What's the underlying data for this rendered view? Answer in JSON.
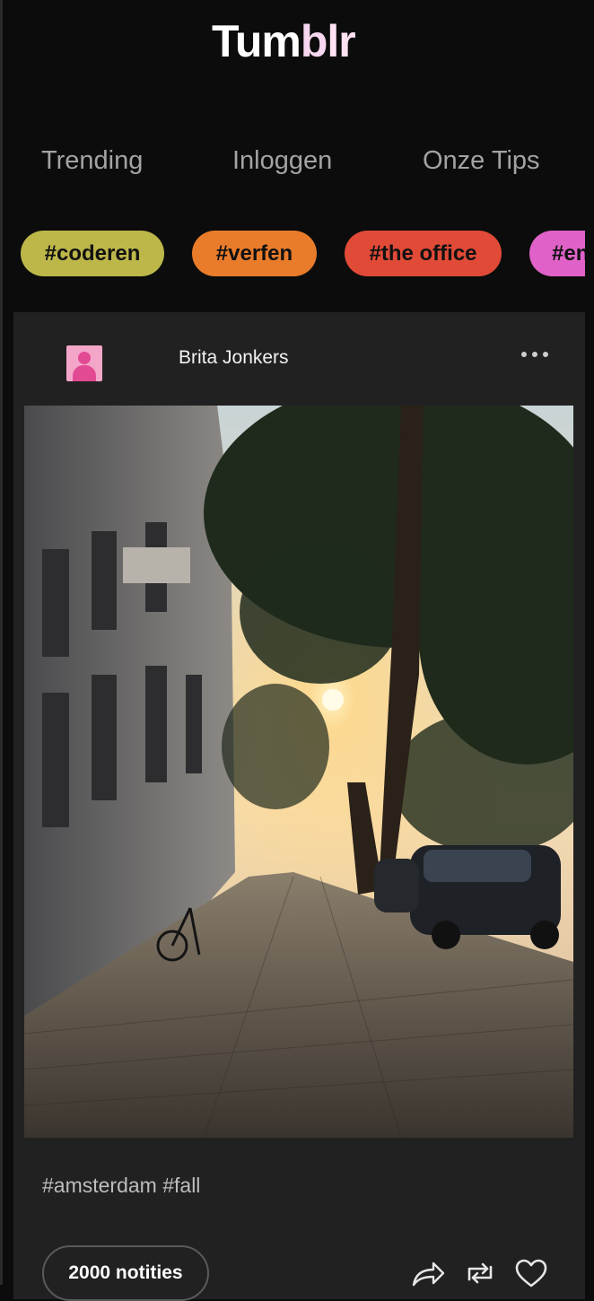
{
  "app": {
    "logo_parts": [
      "Tum",
      "b",
      "lr"
    ]
  },
  "nav": {
    "tabs": [
      {
        "label": "Trending"
      },
      {
        "label": "Inloggen"
      },
      {
        "label": "Onze Tips"
      }
    ]
  },
  "tags": [
    {
      "label": "#coderen",
      "color": "#bdb74a"
    },
    {
      "label": "#verfen",
      "color": "#e97c2b"
    },
    {
      "label": "#the office",
      "color": "#e04a37"
    },
    {
      "label": "#en",
      "color": "#e062c8"
    }
  ],
  "post": {
    "author": "Brita Jonkers",
    "hashtags": "#amsterdam #fall",
    "notes_label": "2000 notities",
    "icons": [
      "share-icon",
      "reblog-icon",
      "like-heart-icon",
      "more-options-icon",
      "avatar-icon"
    ]
  },
  "colors": {
    "background": "#0c0c0c",
    "card": "#212121",
    "tab_text": "#a3a3a3",
    "avatar": "#f4a6c9"
  }
}
